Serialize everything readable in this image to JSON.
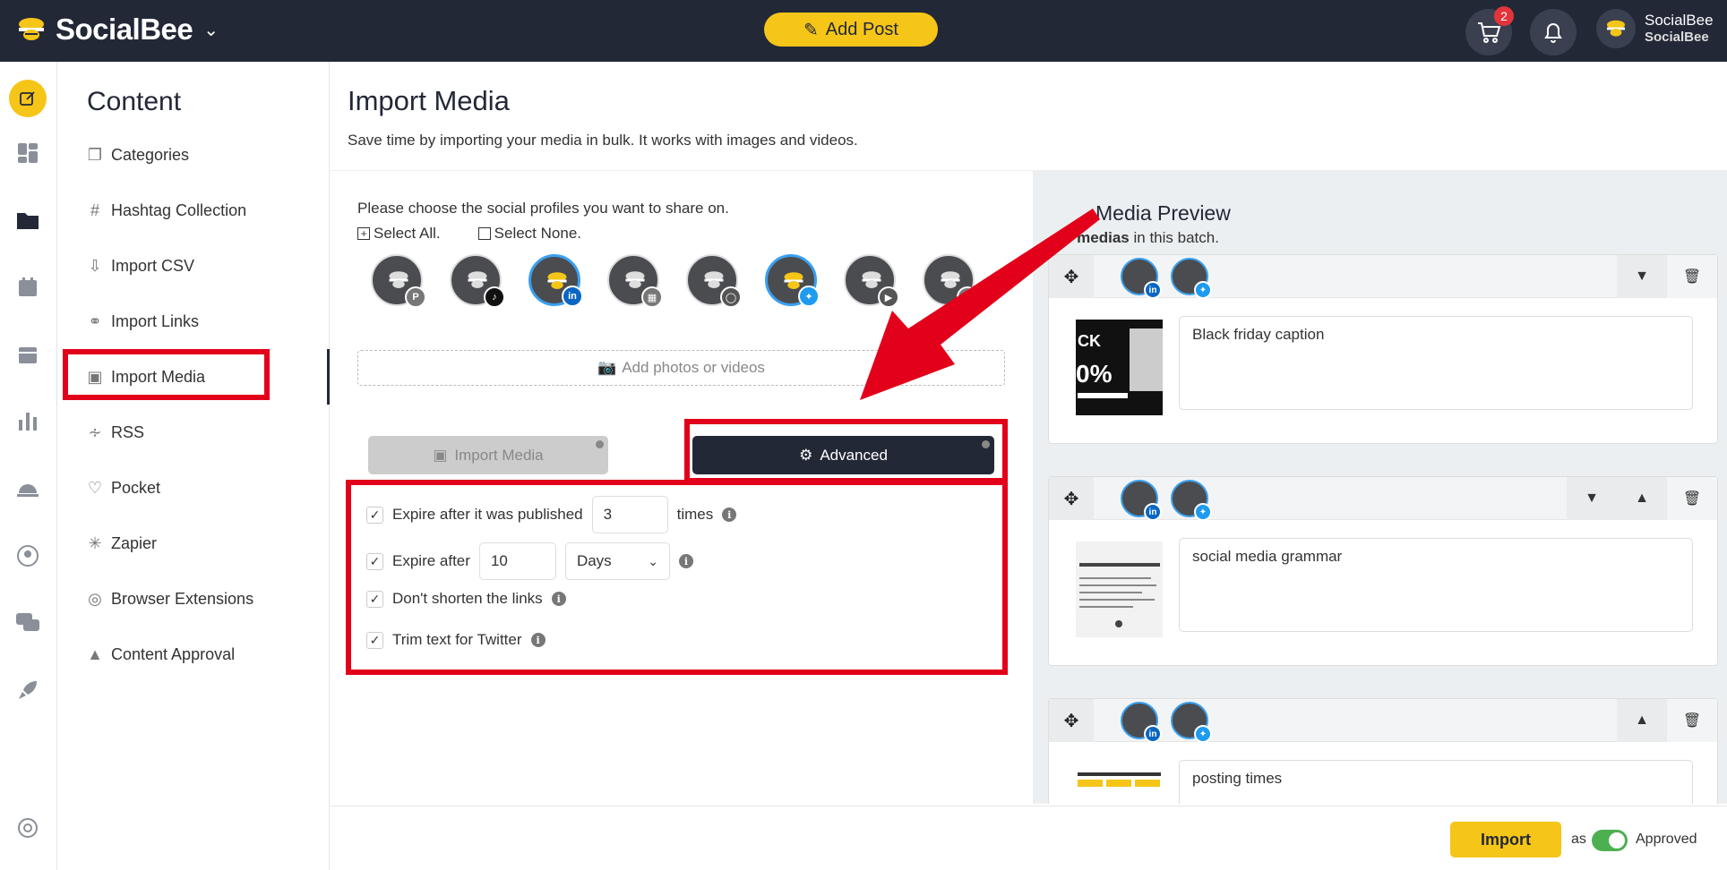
{
  "header": {
    "brand": "SocialBee",
    "add_post_label": "Add Post",
    "cart_badge": "2",
    "account_name": "SocialBee",
    "account_workspace": "SocialBee"
  },
  "sidebar": {
    "title": "Content",
    "items": [
      {
        "label": "Categories",
        "icon": "categories-icon"
      },
      {
        "label": "Hashtag Collection",
        "icon": "hashtag-icon"
      },
      {
        "label": "Import CSV",
        "icon": "import-csv-icon"
      },
      {
        "label": "Import Links",
        "icon": "link-icon"
      },
      {
        "label": "Import Media",
        "icon": "image-icon",
        "active": true
      },
      {
        "label": "RSS",
        "icon": "rss-icon"
      },
      {
        "label": "Pocket",
        "icon": "pocket-icon"
      },
      {
        "label": "Zapier",
        "icon": "zapier-icon"
      },
      {
        "label": "Browser Extensions",
        "icon": "chrome-icon"
      },
      {
        "label": "Content Approval",
        "icon": "thumbs-up-icon"
      }
    ]
  },
  "main": {
    "title": "Import Media",
    "subtitle": "Save time by importing your media in bulk. It works with images and videos.",
    "choose_text": "Please choose the social profiles you want to share on.",
    "select_all": "Select All.",
    "select_none": "Select None.",
    "profiles": [
      {
        "network": "pinterest",
        "selected": false
      },
      {
        "network": "tiktok",
        "selected": false
      },
      {
        "network": "linkedin",
        "selected": true
      },
      {
        "network": "google-business",
        "selected": false
      },
      {
        "network": "instagram",
        "selected": false
      },
      {
        "network": "twitter",
        "selected": true
      },
      {
        "network": "youtube",
        "selected": false
      },
      {
        "network": "facebook",
        "selected": false
      }
    ],
    "add_photos_label": "Add photos or videos",
    "tab_import_media": "Import Media",
    "tab_advanced": "Advanced",
    "options": {
      "expire_published_label": "Expire after it was published",
      "expire_published_value": "3",
      "expire_published_suffix": "times",
      "expire_after_label": "Expire after",
      "expire_after_value": "10",
      "expire_after_unit": "Days",
      "dont_shorten_label": "Don't shorten the links",
      "trim_twitter_label": "Trim text for Twitter"
    }
  },
  "preview": {
    "title": "Media Preview",
    "count_bold": "3 medias",
    "count_rest": " in this batch.",
    "items": [
      {
        "caption": "Black friday caption"
      },
      {
        "caption": "social media grammar"
      },
      {
        "caption": "posting times"
      }
    ]
  },
  "footer": {
    "import_label": "Import",
    "as_label": "as",
    "approved_label": "Approved",
    "approved_on": true
  },
  "colors": {
    "accent_yellow": "#f5c518",
    "dark_navy": "#232837",
    "highlight_red": "#e2001a",
    "linkedin": "#0a66c2",
    "twitter": "#1d9bf0"
  }
}
